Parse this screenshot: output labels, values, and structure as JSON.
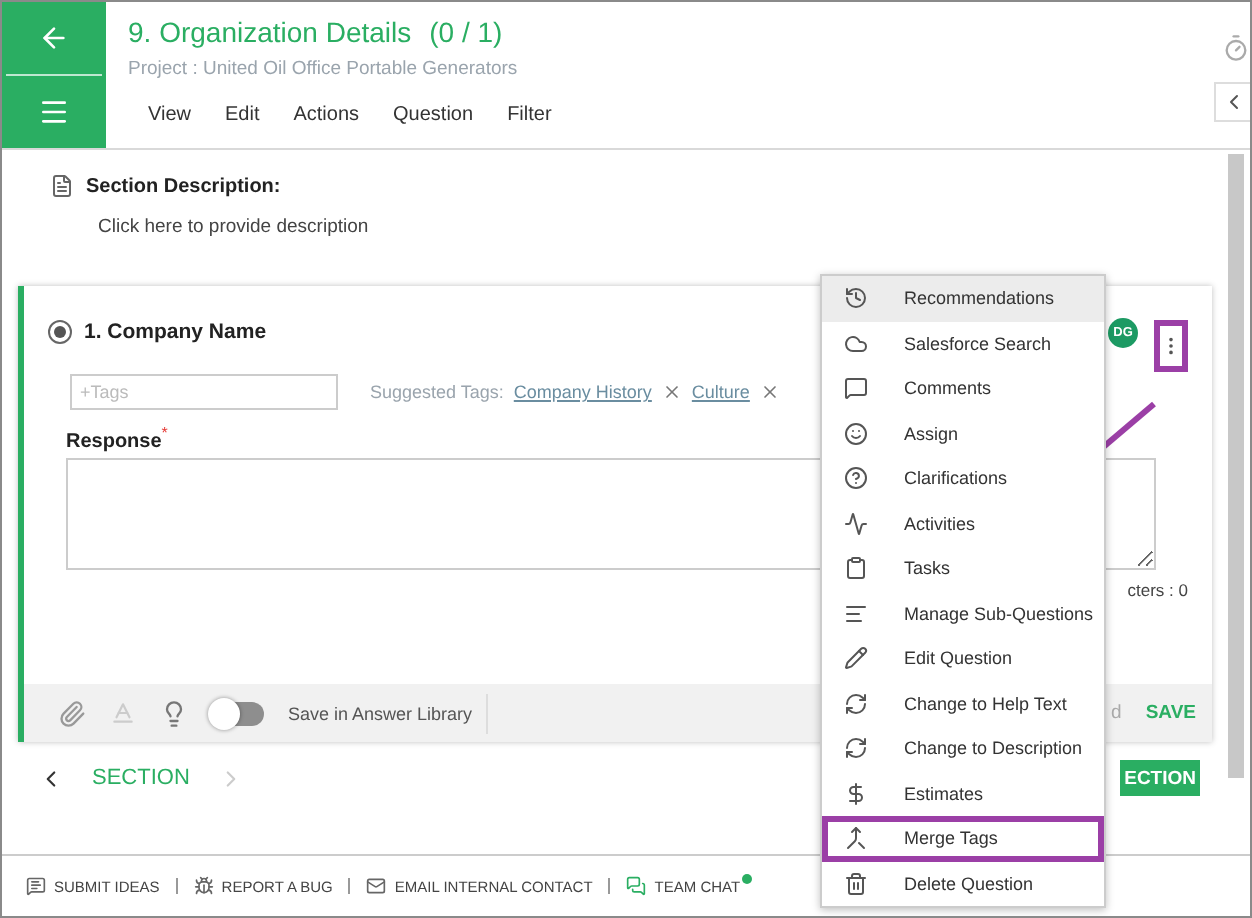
{
  "header": {
    "title": "9. Organization Details",
    "progress": "(0 / 1)",
    "project": "Project : United Oil Office Portable Generators",
    "menu": [
      "View",
      "Edit",
      "Actions",
      "Question",
      "Filter"
    ]
  },
  "section_description": {
    "label": "Section Description:",
    "placeholder": "Click here to provide description"
  },
  "question": {
    "title": "1. Company Name",
    "selected": true,
    "assignee": "DG",
    "menu_highlighted": true,
    "tags": {
      "placeholder": "+Tags",
      "suggested_label": "Suggested Tags:",
      "suggested": [
        "Company History",
        "Culture"
      ]
    },
    "response": {
      "label": "Response",
      "required_mark": "*",
      "char_count": "cters : 0"
    },
    "footer": {
      "save_library": {
        "label": "Save in Answer Library",
        "on": false
      },
      "hidden_button": "d",
      "save": "SAVE"
    }
  },
  "section_nav": {
    "label": "SECTION",
    "next_disabled": true,
    "button": "ECTION"
  },
  "context_menu": [
    {
      "label": "Recommendations",
      "hovered": true,
      "highlighted": false
    },
    {
      "label": "Salesforce Search",
      "hovered": false,
      "highlighted": false
    },
    {
      "label": "Comments",
      "hovered": false,
      "highlighted": false
    },
    {
      "label": "Assign",
      "hovered": false,
      "highlighted": false
    },
    {
      "label": "Clarifications",
      "hovered": false,
      "highlighted": false
    },
    {
      "label": "Activities",
      "hovered": false,
      "highlighted": false
    },
    {
      "label": "Tasks",
      "hovered": false,
      "highlighted": false
    },
    {
      "label": "Manage Sub-Questions",
      "hovered": false,
      "highlighted": false
    },
    {
      "label": "Edit Question",
      "hovered": false,
      "highlighted": false
    },
    {
      "label": "Change to Help Text",
      "hovered": false,
      "highlighted": false
    },
    {
      "label": "Change to Description",
      "hovered": false,
      "highlighted": false
    },
    {
      "label": "Estimates",
      "hovered": false,
      "highlighted": false
    },
    {
      "label": "Merge Tags",
      "hovered": false,
      "highlighted": true
    },
    {
      "label": "Delete Question",
      "hovered": false,
      "highlighted": false
    }
  ],
  "footer_links": [
    {
      "label": "SUBMIT IDEAS"
    },
    {
      "label": "REPORT A BUG"
    },
    {
      "label": "EMAIL INTERNAL CONTACT"
    },
    {
      "label": "TEAM CHAT",
      "online": true
    }
  ]
}
